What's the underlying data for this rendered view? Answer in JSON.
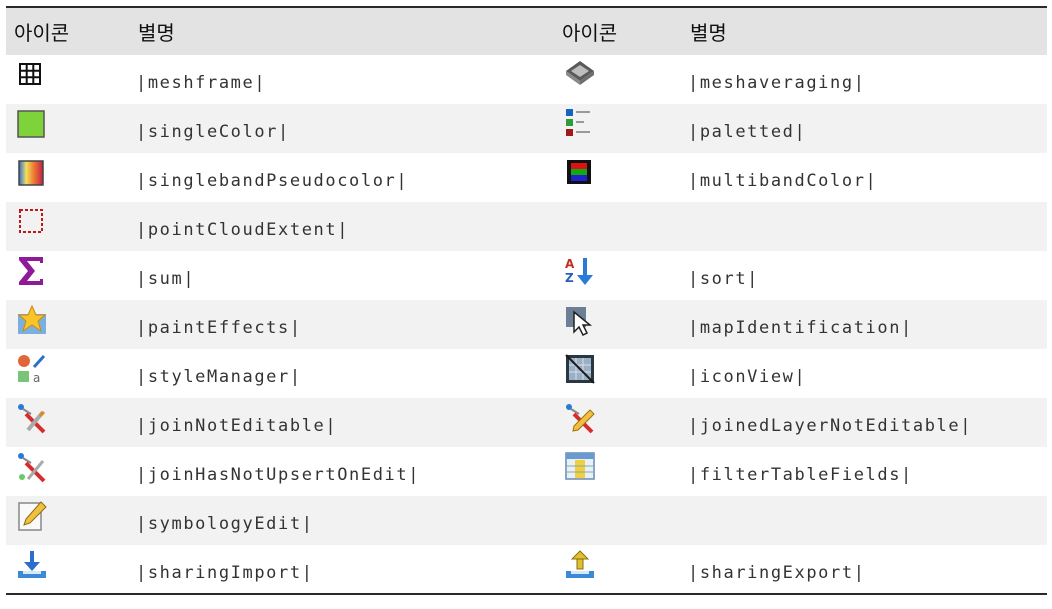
{
  "table": {
    "headers": [
      "아이콘",
      "별명",
      "아이콘",
      "별명"
    ],
    "rows": [
      {
        "left_icon": "mesh-grid-icon",
        "left_alias": "|meshframe|",
        "right_icon": "mesh-averaging-icon",
        "right_alias": "|meshaveraging|"
      },
      {
        "left_icon": "single-color-icon",
        "left_alias": "|singleColor|",
        "right_icon": "paletted-icon",
        "right_alias": "|paletted|"
      },
      {
        "left_icon": "pseudocolor-icon",
        "left_alias": "|singlebandPseudocolor|",
        "right_icon": "multiband-color-icon",
        "right_alias": "|multibandColor|"
      },
      {
        "left_icon": "point-cloud-extent-icon",
        "left_alias": "|pointCloudExtent|",
        "right_icon": "",
        "right_alias": ""
      },
      {
        "left_icon": "sum-icon",
        "left_alias": "|sum|",
        "right_icon": "sort-icon",
        "right_alias": "|sort|"
      },
      {
        "left_icon": "star-icon",
        "left_alias": "|paintEffects|",
        "right_icon": "map-identification-icon",
        "right_alias": "|mapIdentification|"
      },
      {
        "left_icon": "style-manager-icon",
        "left_alias": "|styleManager|",
        "right_icon": "icon-view-icon",
        "right_alias": "|iconView|"
      },
      {
        "left_icon": "join-not-editable-icon",
        "left_alias": "|joinNotEditable|",
        "right_icon": "joined-layer-not-editable-icon",
        "right_alias": "|joinedLayerNotEditable|"
      },
      {
        "left_icon": "join-has-not-upsert-icon",
        "left_alias": "|joinHasNotUpsertOnEdit|",
        "right_icon": "filter-table-fields-icon",
        "right_alias": "|filterTableFields|"
      },
      {
        "left_icon": "symbology-edit-icon",
        "left_alias": "|symbologyEdit|",
        "right_icon": "",
        "right_alias": ""
      },
      {
        "left_icon": "sharing-import-icon",
        "left_alias": "|sharingImport|",
        "right_icon": "sharing-export-icon",
        "right_alias": "|sharingExport|"
      }
    ]
  }
}
